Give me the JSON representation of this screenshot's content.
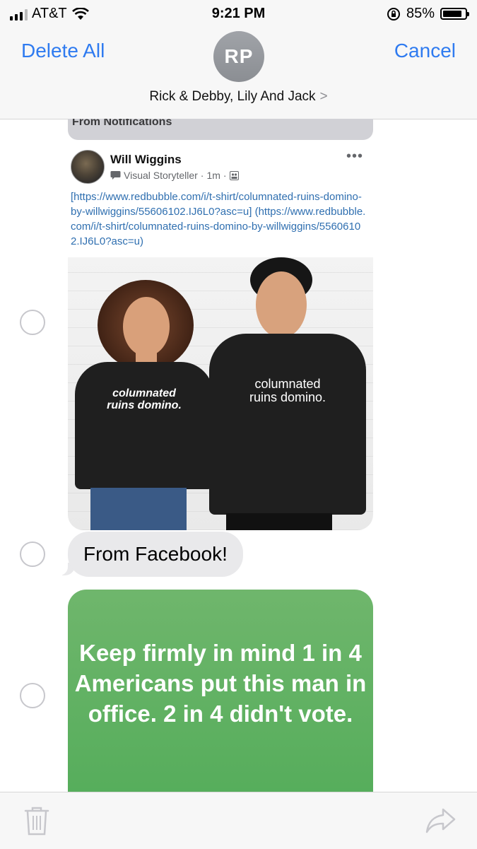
{
  "status_bar": {
    "carrier": "AT&T",
    "time": "9:21 PM",
    "battery": "85%",
    "battery_level": 0.85,
    "signal_bars_on": 3,
    "icons": [
      "signal-icon",
      "wifi-icon",
      "orientation-lock-icon",
      "battery-icon"
    ]
  },
  "header": {
    "delete_all": "Delete All",
    "cancel": "Cancel",
    "avatar_initials": "RP",
    "conversation_name": "Rick & Debby, Lily And Jack",
    "chevron": ">"
  },
  "messages": {
    "notification_header": "From Notifications",
    "facebook_post": {
      "author": "Will Wiggins",
      "role": "Visual Storyteller",
      "time": "1m",
      "more": "•••",
      "post_text": "[https://www.redbubble.com/i/t-shirt/columnated-ruins-domino-by-willwiggins/55606102.IJ6L0?asc=u] (https://www.redbubble.com/i/t-shirt/columnated-ruins-domino-by-willwiggins/55606102.IJ6L0?asc=u)",
      "shirt_text_left": "columnated ruins domino.",
      "shirt_text_right": "columnated ruins domino."
    },
    "grey_bubble": "From Facebook!",
    "image_text": "Keep firmly in mind 1 in 4 Americans put this man in office. 2 in 4 didn't vote."
  },
  "bottom_bar": {
    "icons": [
      "trash-icon",
      "share-icon"
    ]
  }
}
